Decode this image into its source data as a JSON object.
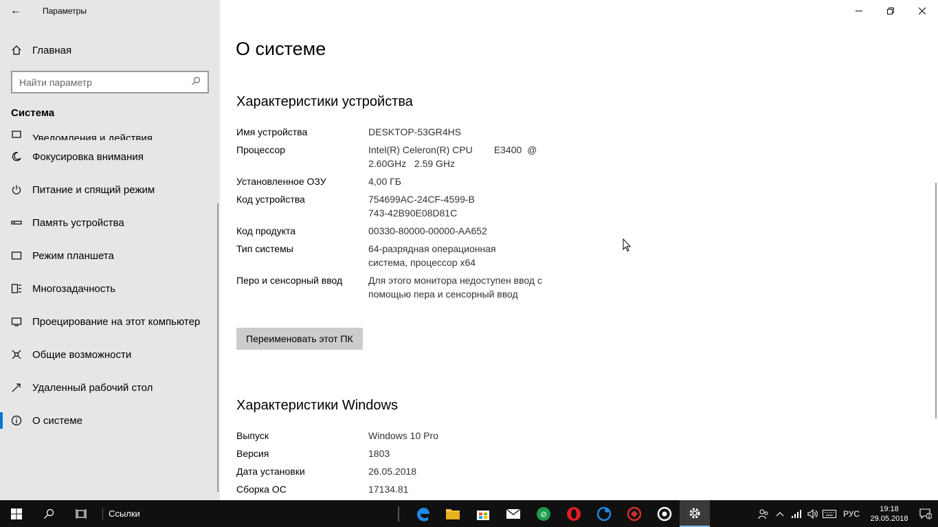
{
  "window": {
    "title": "Параметры",
    "back_icon": "←",
    "controls": {
      "minimize": "—",
      "restore": "❐",
      "close": "✕"
    }
  },
  "sidebar": {
    "home_label": "Главная",
    "search_placeholder": "Найти параметр",
    "section_title": "Система",
    "items": [
      {
        "label": "Уведомления и действия",
        "icon": "notification-icon"
      },
      {
        "label": "Фокусировка внимания",
        "icon": "moon-icon"
      },
      {
        "label": "Питание и спящий режим",
        "icon": "power-icon"
      },
      {
        "label": "Память устройства",
        "icon": "storage-icon"
      },
      {
        "label": "Режим планшета",
        "icon": "tablet-icon"
      },
      {
        "label": "Многозадачность",
        "icon": "multitask-icon"
      },
      {
        "label": "Проецирование на этот компьютер",
        "icon": "project-icon"
      },
      {
        "label": "Общие возможности",
        "icon": "shared-icon"
      },
      {
        "label": "Удаленный рабочий стол",
        "icon": "remote-icon"
      },
      {
        "label": "О системе",
        "icon": "info-icon"
      }
    ]
  },
  "main": {
    "title": "О системе",
    "device_section": "Характеристики устройства",
    "device_specs": [
      {
        "key": "Имя устройства",
        "value": "DESKTOP-53GR4HS"
      },
      {
        "key": "Процессор",
        "value": "Intel(R) Celeron(R) CPU        E3400  @ 2.60GHz   2.59 GHz"
      },
      {
        "key": "Установленное ОЗУ",
        "value": "4,00 ГБ"
      },
      {
        "key": "Код устройства",
        "value": "754699AC-24CF-4599-B743-42B90E08D81C"
      },
      {
        "key": "Код продукта",
        "value": "00330-80000-00000-AA652"
      },
      {
        "key": "Тип системы",
        "value": "64-разрядная операционная система, процессор x64"
      },
      {
        "key": "Перо и сенсорный ввод",
        "value": "Для этого монитора недоступен ввод с помощью пера и сенсорный ввод"
      }
    ],
    "rename_button": "Переименовать этот ПК",
    "windows_section": "Характеристики Windows",
    "windows_specs": [
      {
        "key": "Выпуск",
        "value": "Windows 10 Pro"
      },
      {
        "key": "Версия",
        "value": "1803"
      },
      {
        "key": "Дата установки",
        "value": "26.05.2018"
      },
      {
        "key": "Сборка ОС",
        "value": "17134.81"
      }
    ]
  },
  "taskbar": {
    "links_label": "Ссылки",
    "language": "РУС",
    "time": "19:18",
    "date": "29.05.2018",
    "notifications_count": "2"
  }
}
